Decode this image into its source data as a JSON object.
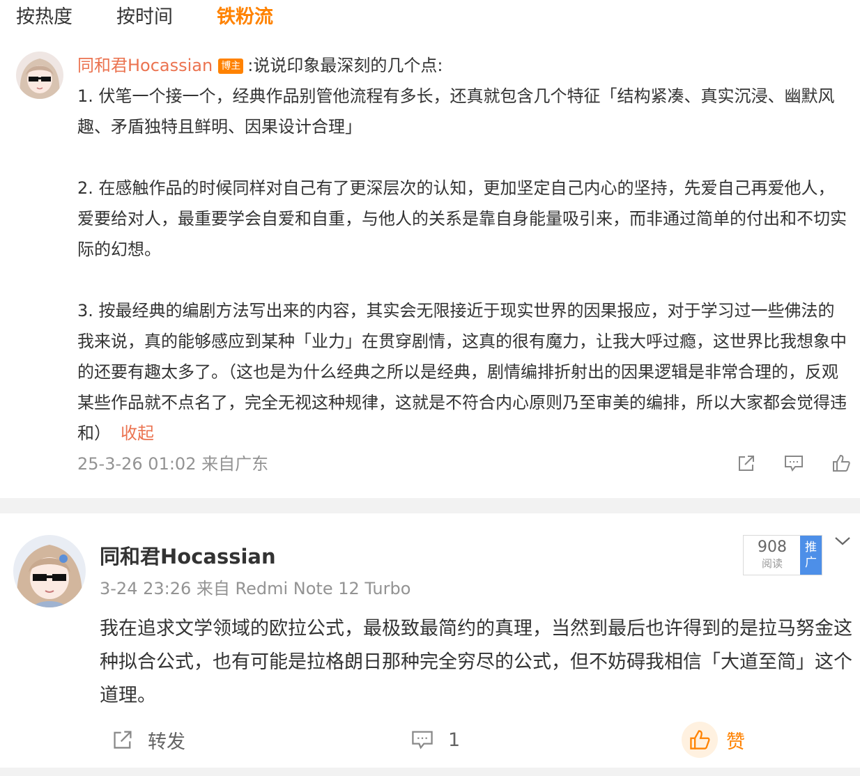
{
  "tabs": [
    {
      "label": "按热度"
    },
    {
      "label": "按时间"
    },
    {
      "label": "铁粉流"
    }
  ],
  "comment": {
    "user": "同和君Hocassian",
    "badge": "博主",
    "intro": ":说说印象最深刻的几个点:",
    "paragraphs": [
      "1. 伏笔一个接一个，经典作品别管他流程有多长，还真就包含几个特征「结构紧凑、真实沉浸、幽默风趣、矛盾独特且鲜明、因果设计合理」",
      "2. 在感触作品的时候同样对自己有了更深层次的认知，更加坚定自己内心的坚持，先爱自己再爱他人，爱要给对人，最重要学会自爱和自重，与他人的关系是靠自身能量吸引来，而非通过简单的付出和不切实际的幻想。",
      "3. 按最经典的编剧方法写出来的内容，其实会无限接近于现实世界的因果报应，对于学习过一些佛法的我来说，真的能够感应到某种「业力」在贯穿剧情，这真的很有魔力，让我大呼过瘾，这世界比我想象中的还要有趣太多了。（这也是为什么经典之所以是经典，剧情编排折射出的因果逻辑是非常合理的，反观某些作品就不点名了，完全无视这种规律，这就是不符合内心原则乃至审美的编排，所以大家都会觉得违和）"
    ],
    "collapse": "收起",
    "meta": "25-3-26 01:02 来自广东",
    "actions": [
      "share-icon",
      "comment-icon",
      "like-icon"
    ]
  },
  "post": {
    "user": "同和君Hocassian",
    "meta": "3-24 23:26 来自 Redmi Note 12 Turbo",
    "reads": {
      "count": "908",
      "label": "阅读"
    },
    "promote": "推广",
    "text": "我在追求文学领域的欧拉公式，最极致最简约的真理，当然到最后也许得到的是拉马努金这种拟合公式，也有可能是拉格朗日那种完全穷尽的公式，但不妨碍我相信「大道至简」这个道理。",
    "forward_label": "转发",
    "comment_count": "1",
    "like_label": "赞"
  },
  "colors": {
    "accent": "#ff8200",
    "username": "#eb7350",
    "muted": "#939393",
    "promote": "#4d8fe8"
  }
}
